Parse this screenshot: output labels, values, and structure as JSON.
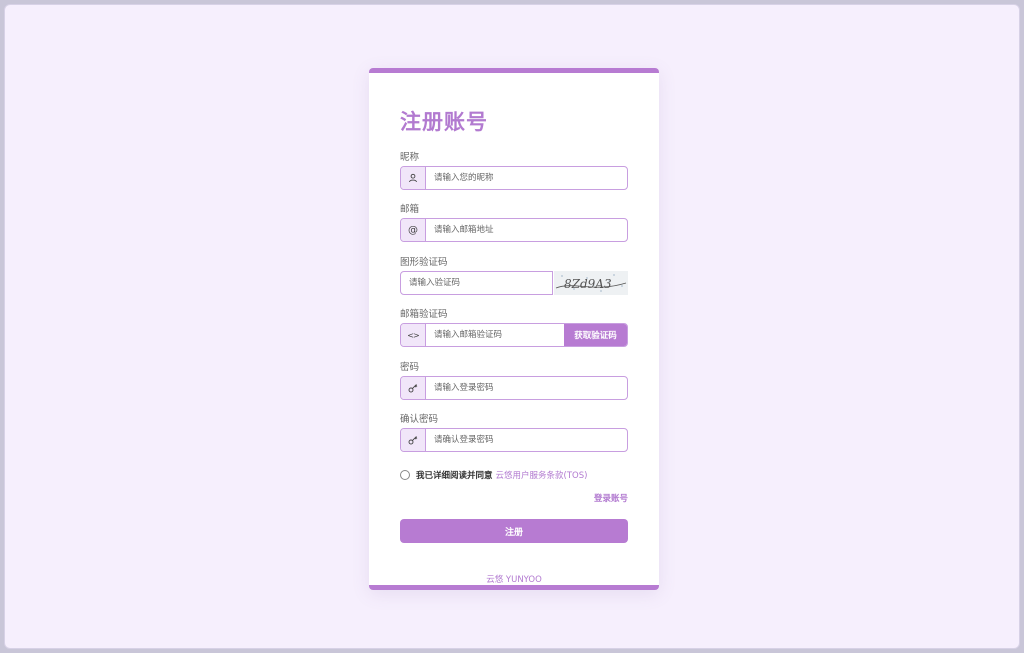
{
  "form": {
    "title": "注册账号",
    "nickname": {
      "label": "昵称",
      "placeholder": "请输入您的昵称",
      "icon": "user-icon"
    },
    "email": {
      "label": "邮箱",
      "placeholder": "请输入邮箱地址",
      "icon": "at-icon"
    },
    "captcha": {
      "label": "图形验证码",
      "placeholder": "请输入验证码",
      "image_text": "8Zd9A3"
    },
    "email_code": {
      "label": "邮箱验证码",
      "placeholder": "请输入邮箱验证码",
      "icon": "code-icon",
      "button": "获取验证码"
    },
    "password": {
      "label": "密码",
      "placeholder": "请输入登录密码",
      "icon": "key-icon"
    },
    "confirm_password": {
      "label": "确认密码",
      "placeholder": "请确认登录密码",
      "icon": "key-icon"
    },
    "agree_text": "我已详细阅读并同意",
    "agree_link": "云悠用户服务条款(TOS)",
    "login_link": "登录账号",
    "submit": "注册"
  },
  "footer": "云悠 YUNYOO",
  "colors": {
    "accent": "#b77bd2",
    "background": "#f6effd",
    "addon": "#f1e6f9"
  }
}
